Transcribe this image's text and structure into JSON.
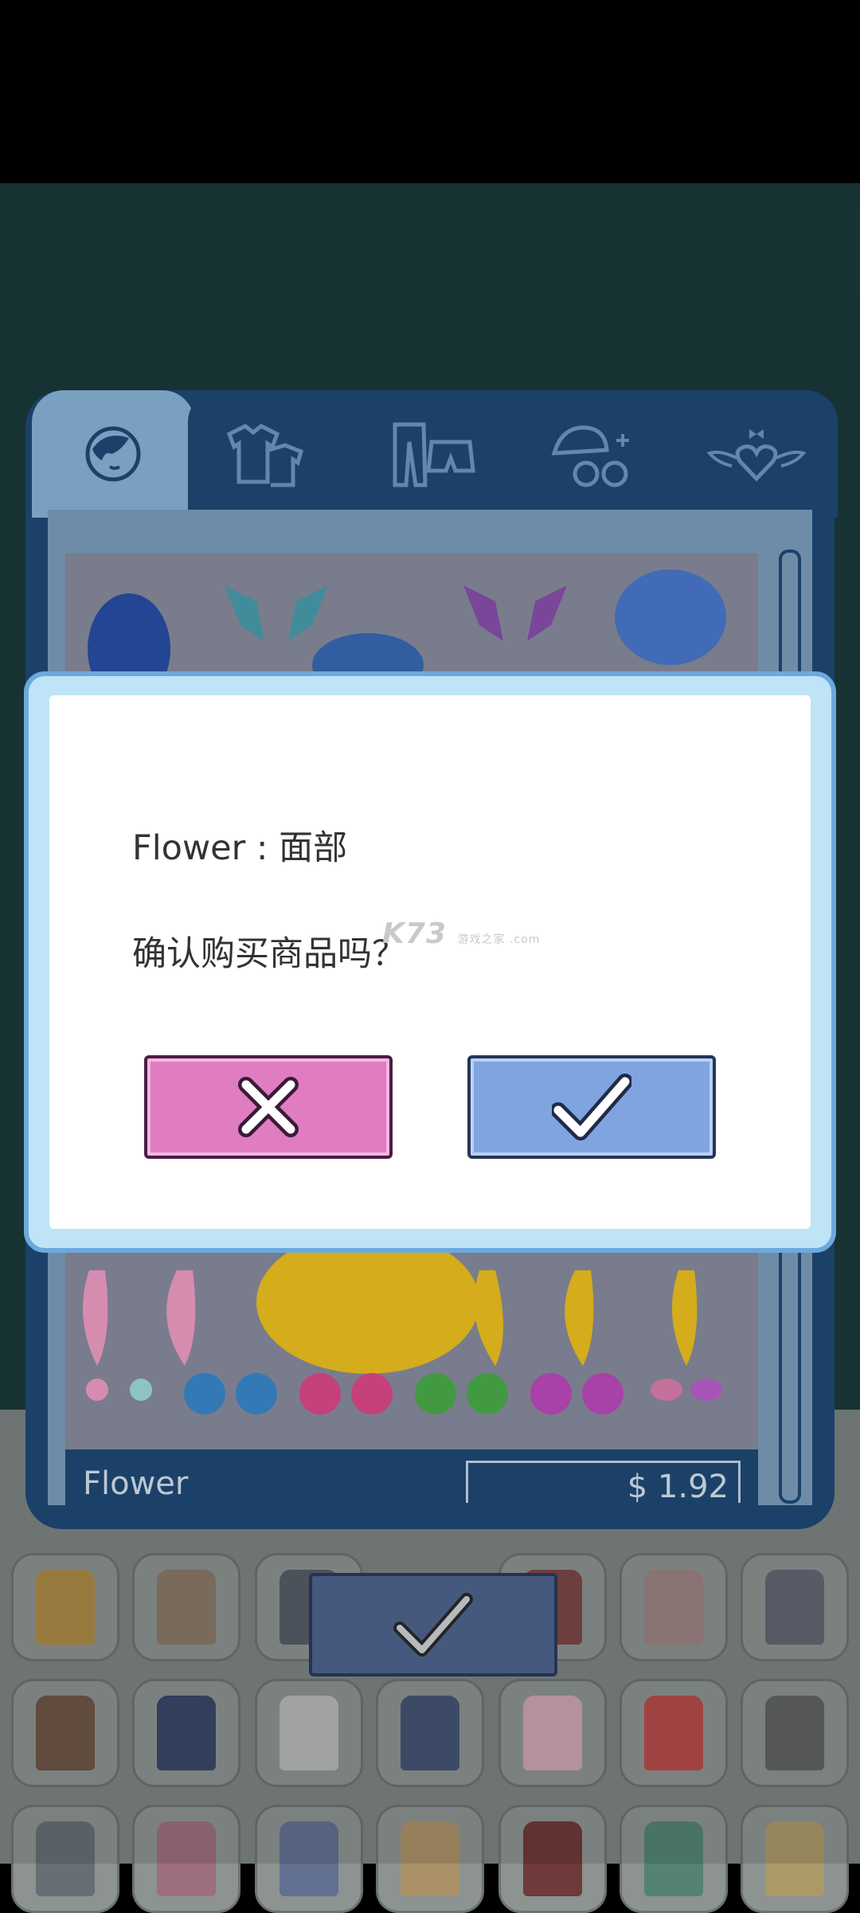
{
  "dialog": {
    "title": "Flower : 面部",
    "message": "确认购买商品吗？",
    "cancel_icon": "close-icon",
    "confirm_icon": "checkmark-icon"
  },
  "watermark": {
    "text": "K73",
    "sub": "游戏之家 .com"
  },
  "shop": {
    "tabs": [
      {
        "icon": "face-icon",
        "active": true
      },
      {
        "icon": "tops-icon",
        "active": false
      },
      {
        "icon": "bottoms-icon",
        "active": false
      },
      {
        "icon": "accessories-icon",
        "active": false
      },
      {
        "icon": "decorations-icon",
        "active": false
      }
    ],
    "item_name": "Flower",
    "item_price": "$ 1.92"
  },
  "colors": {
    "panel": "#1f4a78",
    "cancel": "#e07cc0",
    "confirm": "#80a4e0",
    "dialog_border": "#6ca9dc"
  }
}
